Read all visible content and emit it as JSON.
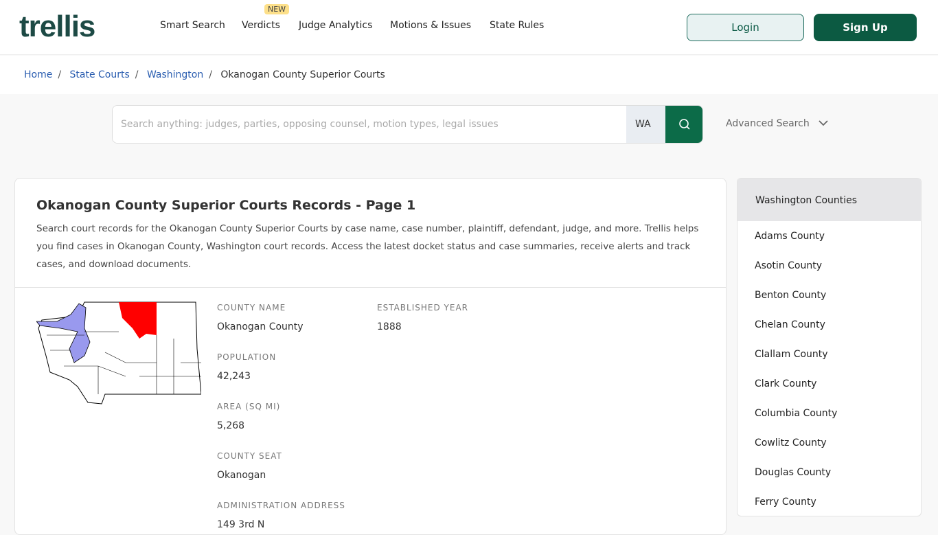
{
  "header": {
    "logo": "trellis",
    "nav": [
      "Smart Search",
      "Verdicts",
      "Judge Analytics",
      "Motions & Issues",
      "State Rules"
    ],
    "new_badge": "NEW",
    "login": "Login",
    "signup": "Sign Up"
  },
  "breadcrumb": [
    "Home",
    "State Courts",
    "Washington",
    "Okanogan County Superior Courts"
  ],
  "search": {
    "placeholder": "Search anything: judges, parties, opposing counsel, motion types, legal issues",
    "state": "WA",
    "advanced": "Advanced Search"
  },
  "main": {
    "title": "Okanogan County Superior Courts Records - Page 1",
    "description": "Search court records for the Okanogan County Superior Courts by case name, case number, plaintiff, defendant, judge, and more. Trellis helps you find cases in Okanogan County, Washington court records. Access the latest docket status and case summaries, receive alerts and track cases, and download documents.",
    "facts": {
      "county_name_label": "COUNTY NAME",
      "county_name": "Okanogan County",
      "established_label": "ESTABLISHED YEAR",
      "established": "1888",
      "population_label": "POPULATION",
      "population": "42,243",
      "area_label": "AREA (SQ MI)",
      "area": "5,268",
      "seat_label": "COUNTY SEAT",
      "seat": "Okanogan",
      "address_label": "ADMINISTRATION ADDRESS",
      "address": "149 3rd N"
    },
    "map_colors": {
      "highlight": "#ff0000",
      "water": "#9999ee"
    }
  },
  "sidebar": {
    "title": "Washington Counties",
    "items": [
      "Adams County",
      "Asotin County",
      "Benton County",
      "Chelan County",
      "Clallam County",
      "Clark County",
      "Columbia County",
      "Cowlitz County",
      "Douglas County",
      "Ferry County"
    ]
  }
}
